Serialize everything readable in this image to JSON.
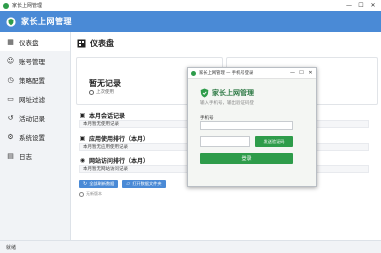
{
  "window": {
    "title": "家长上网管理",
    "min_glyph": "—",
    "max_glyph": "☐",
    "close_glyph": "✕"
  },
  "header": {
    "app_name": "家长上网管理"
  },
  "sidebar": {
    "items": [
      {
        "label": "仪表盘",
        "icon": "dashboard-icon"
      },
      {
        "label": "账号管理",
        "icon": "user-icon"
      },
      {
        "label": "策略配置",
        "icon": "clock-icon"
      },
      {
        "label": "网址过滤",
        "icon": "filter-icon"
      },
      {
        "label": "活动记录",
        "icon": "history-icon"
      },
      {
        "label": "系统设置",
        "icon": "gear-icon"
      },
      {
        "label": "日志",
        "icon": "log-icon"
      }
    ]
  },
  "main": {
    "title": "仪表盘",
    "card1": {
      "big": "暂无记录",
      "sub": "上次使用"
    },
    "sections": [
      {
        "title": "本月会话记录",
        "record": "本月暂无使用记录"
      },
      {
        "title": "应用使用排行（本月）",
        "record": "本月暂无应用使用记录"
      },
      {
        "title": "网站访问排行（本月）",
        "record": "本月暂无网站访问记录"
      }
    ],
    "actions": {
      "refresh": "全部刷新数据",
      "open_dir": "打开数据文件夹"
    },
    "footer": "无新版本"
  },
  "status": {
    "text": "就绪"
  },
  "dialog": {
    "title": "家长上网管理 — 手机号登录",
    "brand": "家长上网管理",
    "subtitle": "输入手机号，输出验证码登",
    "phone_label": "手机号",
    "phone_value": "",
    "code_value": "",
    "send_code": "发送验证码",
    "login": "登录"
  },
  "colors": {
    "header": "#4a8ad6",
    "brand_green": "#2e9c4a"
  }
}
